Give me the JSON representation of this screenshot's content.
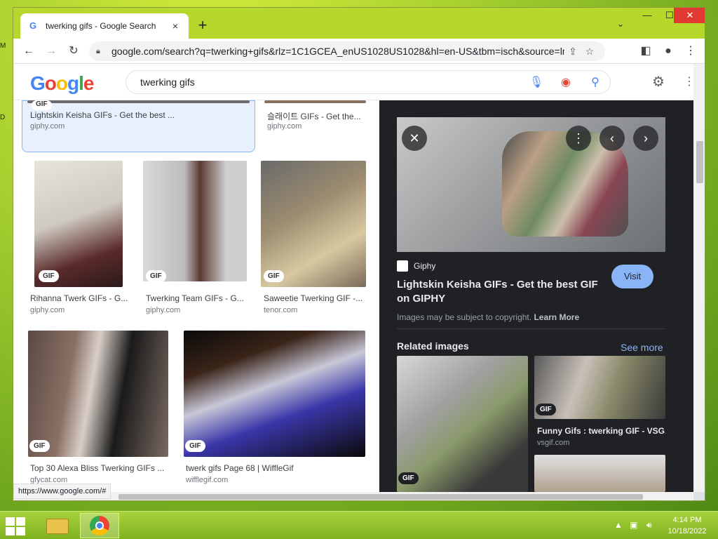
{
  "browser": {
    "tab_title": "twerking gifs - Google Search",
    "tab_close": "×",
    "new_tab": "+",
    "url": "google.com/search?q=twerking+gifs&rlz=1C1GCEA_enUS1028US1028&hl=en-US&tbm=isch&source=ln...",
    "status_url": "https://www.google.com/#"
  },
  "search": {
    "logo": [
      "G",
      "o",
      "o",
      "g",
      "l",
      "e"
    ],
    "query": "twerking gifs"
  },
  "results": {
    "gif_badge": "GIF",
    "top_row": [
      {
        "title": "Lightskin Keisha GIFs - Get the best ...",
        "source": "giphy.com"
      },
      {
        "title": "슬래이트 GIFs - Get the...",
        "source": "giphy.com"
      }
    ],
    "row2": [
      {
        "title": "Rihanna Twerk GIFs - G...",
        "source": "giphy.com"
      },
      {
        "title": "Twerking Team GIFs - G...",
        "source": "giphy.com"
      },
      {
        "title": "Saweetie Twerking GIF -...",
        "source": "tenor.com"
      }
    ],
    "row3": [
      {
        "title": "Top 30 Alexa Bliss Twerking GIFs ...",
        "source": "gfycat.com"
      },
      {
        "title": "twerk gifs Page 68 | WiffleGif",
        "source": "wifflegif.com"
      }
    ]
  },
  "panel": {
    "source_name": "Giphy",
    "title": "Lightskin Keisha GIFs - Get the best GIF on GIPHY",
    "visit_label": "Visit",
    "copyright_text": "Images may be subject to copyright.",
    "learn_more": "Learn More",
    "related_heading": "Related images",
    "see_more": "See more",
    "related": [
      {
        "title": "",
        "source": "",
        "badge": "GIF"
      },
      {
        "title": "Funny Gifs : twerking GIF - VSG...",
        "source": "vsgif.com",
        "badge": "GIF"
      }
    ]
  },
  "taskbar": {
    "time": "4:14 PM",
    "date": "10/18/2022"
  }
}
